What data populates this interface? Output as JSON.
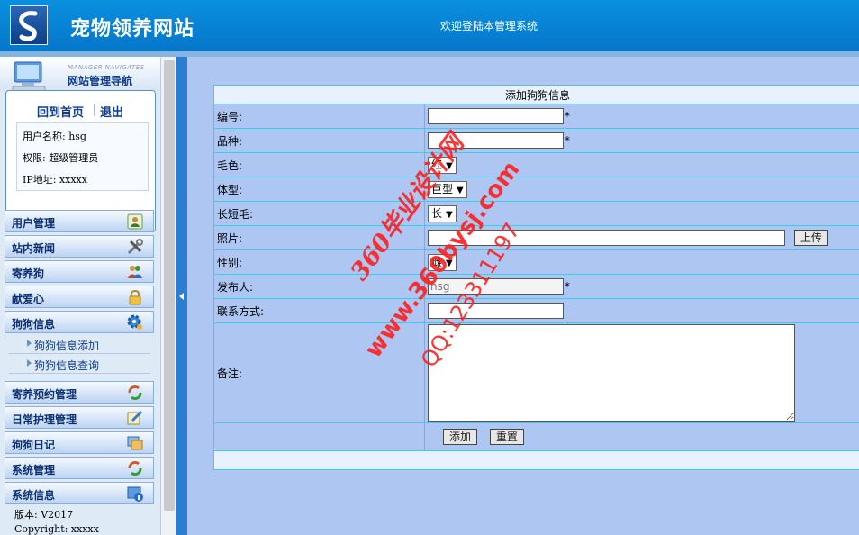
{
  "header": {
    "site_title": "宠物领养网站",
    "welcome": "欢迎登陆本管理系统",
    "colors": {
      "header_bg": "#0a8fe0",
      "accent": "#2a7dd1",
      "main_bg": "#adc6f2",
      "border": "#39cdea"
    }
  },
  "nav": {
    "head_en": "MANAGER NAVIGATES",
    "head_cn": "网站管理导航",
    "home": "回到首页",
    "separator": "|",
    "logout": "退出",
    "user_name": "用户名称: hsg",
    "role": "权限: 超级管理员",
    "ip": "IP地址: xxxxx",
    "menu": [
      {
        "label": "用户管理",
        "icon": "user-icon"
      },
      {
        "label": "站内新闻",
        "icon": "tools-icon"
      },
      {
        "label": "寄养狗",
        "icon": "people-icon"
      },
      {
        "label": "献爱心",
        "icon": "lock-icon"
      },
      {
        "label": "狗狗信息",
        "icon": "gear-icon"
      }
    ],
    "submenu": [
      "狗狗信息添加",
      "狗狗信息查询"
    ],
    "menu2": [
      {
        "label": "寄养预约管理",
        "icon": "refresh-icon"
      },
      {
        "label": "日常护理管理",
        "icon": "edit-icon"
      },
      {
        "label": "狗狗日记",
        "icon": "images-icon"
      },
      {
        "label": "系统管理",
        "icon": "refresh-icon"
      },
      {
        "label": "系统信息",
        "icon": "info-icon"
      }
    ],
    "version": "版本:  V2017",
    "copyright": "Copyright: xxxxx"
  },
  "form": {
    "caption": "添加狗狗信息",
    "required_mark": "*",
    "labels": {
      "id": "编号:",
      "breed": "品种:",
      "color": "毛色:",
      "size": "体型:",
      "hair": "长短毛:",
      "photo": "照片:",
      "gender": "性别:",
      "publisher": "发布人:",
      "contact": "联系方式:",
      "note": "备注:"
    },
    "values": {
      "id": "",
      "breed": "",
      "color": "红",
      "size": "巨型",
      "hair": "长",
      "photo": "",
      "gender": "雌",
      "publisher": "hsg",
      "contact": "",
      "note": ""
    },
    "upload": "上传",
    "submit": "添加",
    "reset": "重置"
  },
  "watermark": {
    "line1": "360毕业设计网",
    "line2": "www.360bysj.com",
    "line3": "QQ:123311197"
  }
}
